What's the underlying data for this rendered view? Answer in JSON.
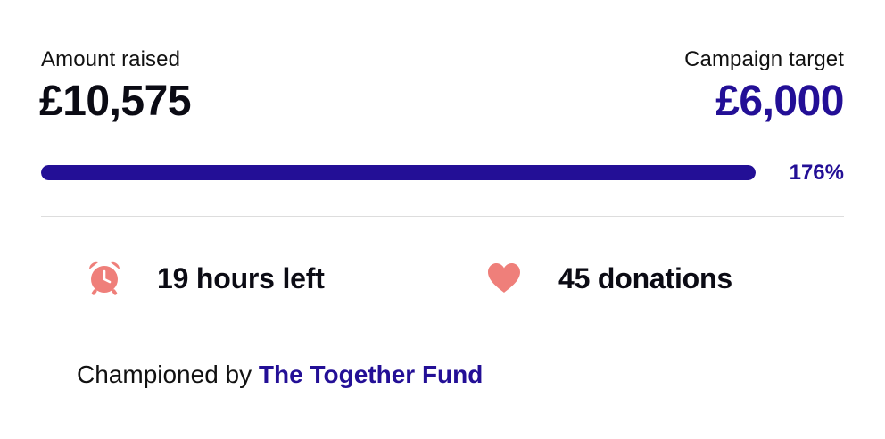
{
  "summary": {
    "amount_raised_label": "Amount raised",
    "amount_raised_value": "£10,575",
    "target_label": "Campaign target",
    "target_value": "£6,000"
  },
  "progress": {
    "percent_label": "176%",
    "percent_value": 176,
    "fill_fraction": 1.0,
    "fill_color": "#230f96",
    "track_color": "#e8e6f3"
  },
  "stats": {
    "time_left": {
      "icon": "alarm-clock-icon",
      "text": "19 hours left",
      "icon_color": "#ef7f7a"
    },
    "donations": {
      "icon": "heart-icon",
      "text": "45 donations",
      "icon_color": "#ef7f7a"
    }
  },
  "champion": {
    "prefix": "Championed by",
    "name": "The Together Fund"
  },
  "colors": {
    "accent": "#230f96",
    "text": "#0b0b14",
    "icon": "#ef7f7a",
    "divider": "#dddddd"
  }
}
